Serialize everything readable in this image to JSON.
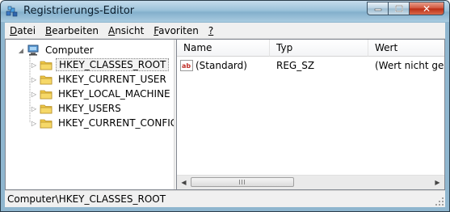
{
  "window": {
    "title": "Registrierungs-Editor",
    "icon": "registry-editor-icon",
    "buttons": [
      "minimize",
      "maximize",
      "close"
    ],
    "close_glyph": "✕"
  },
  "menu": [
    {
      "accel": "D",
      "rest": "atei"
    },
    {
      "accel": "B",
      "rest": "earbeiten"
    },
    {
      "accel": "A",
      "rest": "nsicht"
    },
    {
      "accel": "F",
      "rest": "avoriten"
    },
    {
      "accel": "?",
      "rest": ""
    }
  ],
  "tree": {
    "root": "Computer",
    "keys": [
      "HKEY_CLASSES_ROOT",
      "HKEY_CURRENT_USER",
      "HKEY_LOCAL_MACHINE",
      "HKEY_USERS",
      "HKEY_CURRENT_CONFIG"
    ],
    "selected_index": 0
  },
  "list": {
    "columns": [
      "Name",
      "Typ",
      "Wert"
    ],
    "rows": [
      {
        "name": "(Standard)",
        "type": "REG_SZ",
        "value": "(Wert nicht gesetzt)",
        "icon": "ab-string-icon"
      }
    ]
  },
  "status": {
    "path": "Computer\\HKEY_CLASSES_ROOT"
  },
  "colors": {
    "titlebar": "#9cc2da",
    "folder": "#f0c845",
    "close_button": "#c83a1e"
  }
}
